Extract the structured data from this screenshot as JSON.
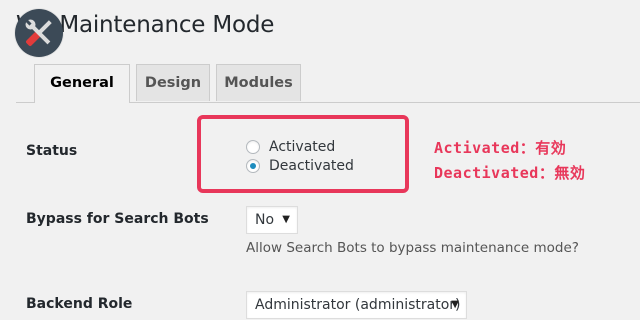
{
  "page": {
    "title": "WP Maintenance Mode"
  },
  "tabs": [
    {
      "label": "General",
      "active": true
    },
    {
      "label": "Design",
      "active": false
    },
    {
      "label": "Modules",
      "active": false
    }
  ],
  "status": {
    "label": "Status",
    "options": [
      {
        "label": "Activated",
        "checked": false
      },
      {
        "label": "Deactivated",
        "checked": true
      }
    ]
  },
  "bypass": {
    "label": "Bypass for Search Bots",
    "value": "No",
    "description": "Allow Search Bots to bypass maintenance mode?"
  },
  "backend_role": {
    "label": "Backend Role",
    "value": "Administrator (administrator)"
  },
  "annotations": {
    "line1": "Activated：有効",
    "line2": "Deactivated：無効"
  },
  "colors": {
    "accent": "#e8375a",
    "radio_checked": "#1e8cbe",
    "logo_bg": "#3c4a57"
  }
}
